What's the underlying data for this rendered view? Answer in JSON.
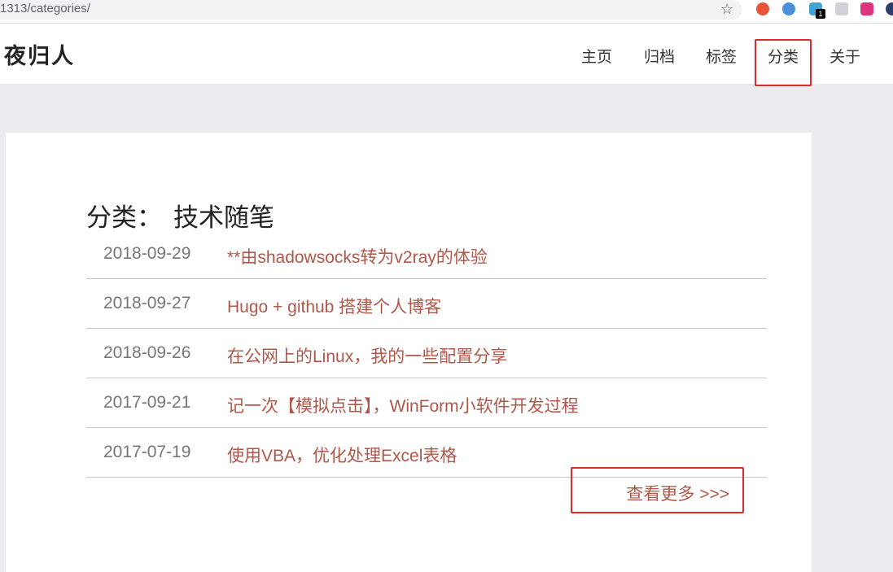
{
  "browser": {
    "url": "1313/categories/",
    "extension_badge": "1"
  },
  "site": {
    "logo": "夜归人",
    "nav": [
      "主页",
      "归档",
      "标签",
      "分类",
      "关于"
    ]
  },
  "category": {
    "label": "分类：",
    "name": "技术随笔"
  },
  "posts": [
    {
      "date": "2018-09-29",
      "title": "**由shadowsocks转为v2ray的体验"
    },
    {
      "date": "2018-09-27",
      "title": "Hugo + github 搭建个人博客"
    },
    {
      "date": "2018-09-26",
      "title": "在公网上的Linux，我的一些配置分享"
    },
    {
      "date": "2017-09-21",
      "title": "记一次【模拟点击】，WinForm小软件开发过程"
    },
    {
      "date": "2017-07-19",
      "title": "使用VBA，优化处理Excel表格"
    }
  ],
  "more": "查看更多 >>>",
  "colors": {
    "accent_link": "#b0574a",
    "highlight_box": "#e02b2b"
  }
}
